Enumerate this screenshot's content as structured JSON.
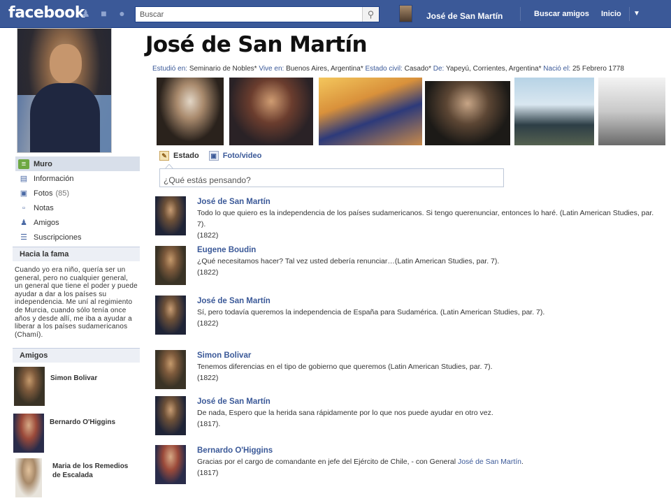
{
  "topbar": {
    "logo": "facebook",
    "search_placeholder": "Buscar",
    "user_name": "José de San Martín",
    "links": [
      "Buscar amigos",
      "Inicio"
    ]
  },
  "profile": {
    "name": "José de San Martín",
    "info": [
      {
        "label": "Estudió en:",
        "value": "Seminario de Nobles"
      },
      {
        "label": "Vive en:",
        "value": "Buenos Aires, Argentina"
      },
      {
        "label": "Estado civil:",
        "value": "Casado"
      },
      {
        "label": "De:",
        "value": "Yapeyú, Corrientes, Argentina"
      },
      {
        "label": "Nació el:",
        "value": "25 Febrero 1778"
      }
    ]
  },
  "nav": [
    {
      "label": "Muro",
      "icon": "wall-icon",
      "active": true
    },
    {
      "label": "Información",
      "icon": "info-card-icon"
    },
    {
      "label": "Fotos",
      "count": "(85)",
      "icon": "photos-icon"
    },
    {
      "label": "Notas",
      "icon": "notes-icon"
    },
    {
      "label": "Amigos",
      "icon": "friends-icon"
    },
    {
      "label": "Suscripciones",
      "icon": "subscriptions-icon"
    }
  ],
  "fame": {
    "heading": "Hacia la fama",
    "text": "Cuando yo era niño, quería ser un general, pero no cualquier general, un general que tiene el poder y puede ayudar a dar a los países su independencia. Me uní al regimiento de Murcia, cuando sólo tenía once años y desde allí, me iba a ayudar a liberar a los países sudamericanos (Chamí)."
  },
  "friends": {
    "heading": "Amigos",
    "list": [
      {
        "name": "Simon Bolivar"
      },
      {
        "name": "Bernardo O'Higgins"
      },
      {
        "name": "Maria de los Remedios de Escalada"
      }
    ]
  },
  "composer": {
    "tab_status": "Estado",
    "tab_photo": "Foto/video",
    "placeholder": "¿Qué estás pensando?"
  },
  "posts": [
    {
      "author": "José de San Martín",
      "text": "Todo lo que quiero es la independencia de los países sudamericanos. Si tengo querenunciar, entonces lo haré. (Latin American Studies, par. 7).",
      "date": "(1822)"
    },
    {
      "author": "Eugene Boudin",
      "text": "¿Qué necesitamos hacer? Tal vez usted debería renunciar…(Latin American Studies, par. 7).",
      "date": "(1822)"
    },
    {
      "author": "José de San Martín",
      "text": "Sí, pero todavía queremos la independencia de España para Sudamérica. (Latin American Studies, par. 7).",
      "date": "(1822)"
    },
    {
      "author": "Simon Bolivar",
      "text": "Tenemos diferencias en el tipo de gobierno que queremos (Latin American Studies, par. 7).",
      "date": "(1822)"
    },
    {
      "author": "José de San Martín",
      "text": "De nada, Espero que la herida sana rápidamente por lo que nos puede ayudar en otro vez.",
      "date": "(1817)."
    },
    {
      "author": "Bernardo O'Higgins",
      "text": "Gracias por el cargo de comandante en jefe del Ejército de Chile, - con General",
      "mention": "José de San Martín",
      "tail": ".",
      "date": "(1817)"
    }
  ],
  "colors": {
    "brand": "#3b5998",
    "nav_active": "#d8dfea",
    "box_head": "#eceff5"
  }
}
